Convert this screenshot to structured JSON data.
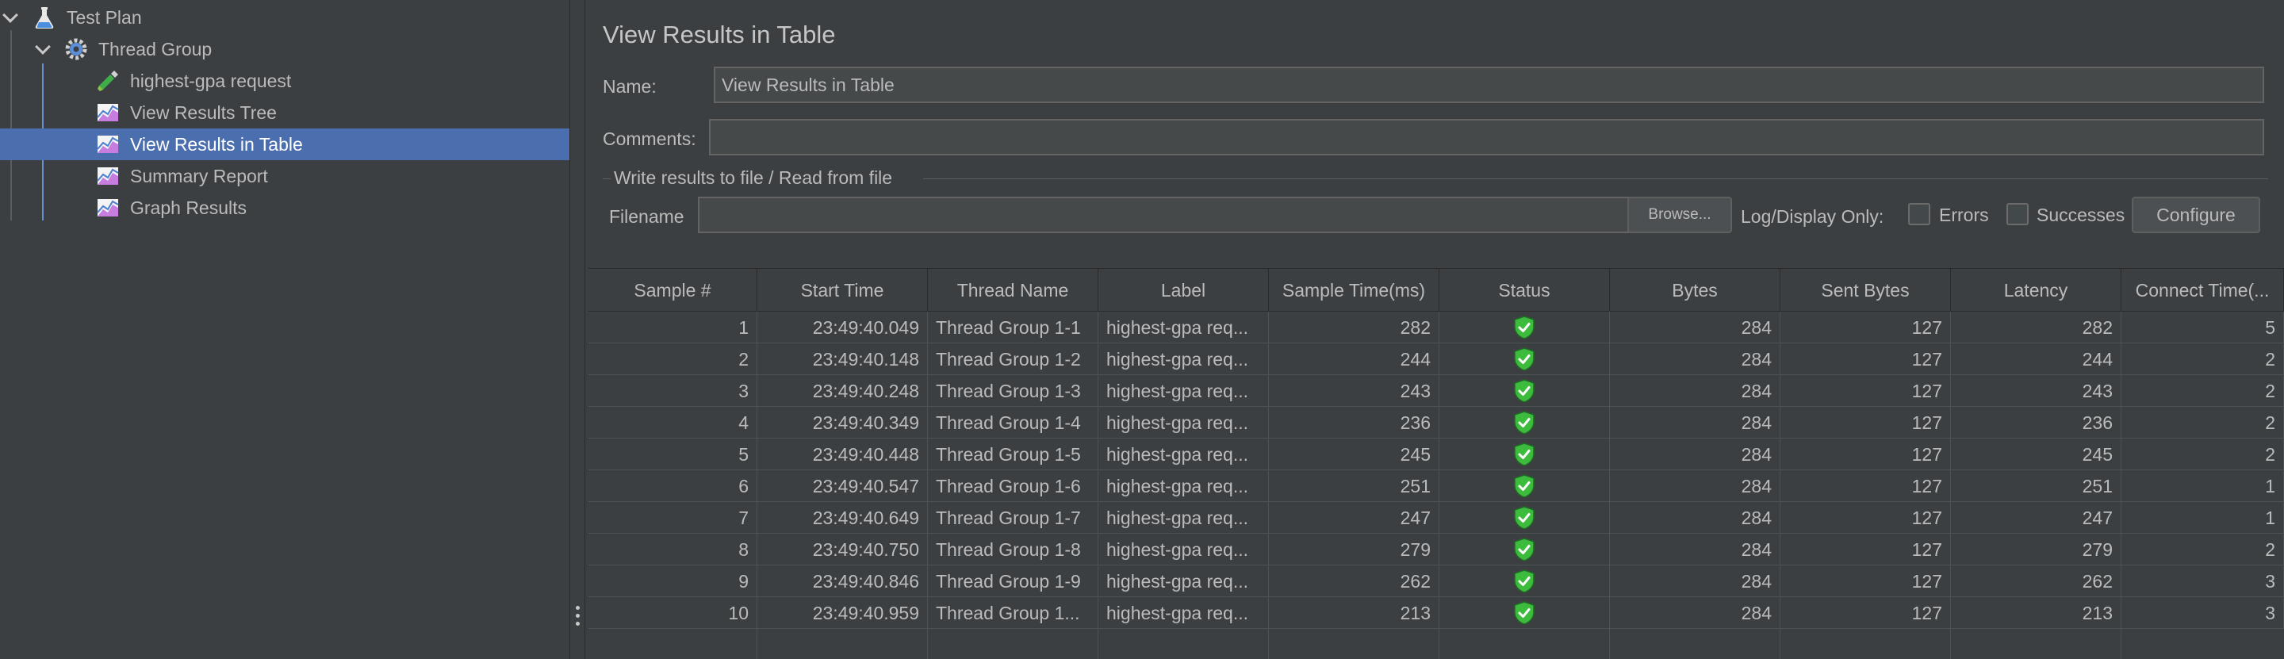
{
  "tree": {
    "items": [
      {
        "label": "Test Plan",
        "icon": "flask-icon"
      },
      {
        "label": "Thread Group",
        "icon": "gear-icon"
      },
      {
        "label": "highest-gpa request",
        "icon": "pipette-icon"
      },
      {
        "label": "View Results Tree",
        "icon": "graph-icon"
      },
      {
        "label": "View Results in Table",
        "icon": "graph-icon"
      },
      {
        "label": "Summary Report",
        "icon": "graph-icon"
      },
      {
        "label": "Graph Results",
        "icon": "graph-icon"
      }
    ],
    "selected_index": 4,
    "selection_color": "#4b6eaf"
  },
  "panel": {
    "title": "View Results in Table",
    "name_label": "Name:",
    "name_value": "View Results in Table",
    "comments_label": "Comments:",
    "comments_value": "",
    "file_group_title": "Write results to file / Read from file",
    "filename_label": "Filename",
    "filename_value": "",
    "browse_label": "Browse...",
    "log_display_label": "Log/Display Only:",
    "errors_label": "Errors",
    "successes_label": "Successes",
    "configure_label": "Configure"
  },
  "table": {
    "columns": [
      "Sample #",
      "Start Time",
      "Thread Name",
      "Label",
      "Sample Time(ms)",
      "Status",
      "Bytes",
      "Sent Bytes",
      "Latency",
      "Connect Time(..."
    ],
    "rows": [
      [
        "1",
        "23:49:40.049",
        "Thread Group 1-1",
        "highest-gpa req...",
        "282",
        "success",
        "284",
        "127",
        "282",
        "5"
      ],
      [
        "2",
        "23:49:40.148",
        "Thread Group 1-2",
        "highest-gpa req...",
        "244",
        "success",
        "284",
        "127",
        "244",
        "2"
      ],
      [
        "3",
        "23:49:40.248",
        "Thread Group 1-3",
        "highest-gpa req...",
        "243",
        "success",
        "284",
        "127",
        "243",
        "2"
      ],
      [
        "4",
        "23:49:40.349",
        "Thread Group 1-4",
        "highest-gpa req...",
        "236",
        "success",
        "284",
        "127",
        "236",
        "2"
      ],
      [
        "5",
        "23:49:40.448",
        "Thread Group 1-5",
        "highest-gpa req...",
        "245",
        "success",
        "284",
        "127",
        "245",
        "2"
      ],
      [
        "6",
        "23:49:40.547",
        "Thread Group 1-6",
        "highest-gpa req...",
        "251",
        "success",
        "284",
        "127",
        "251",
        "1"
      ],
      [
        "7",
        "23:49:40.649",
        "Thread Group 1-7",
        "highest-gpa req...",
        "247",
        "success",
        "284",
        "127",
        "247",
        "1"
      ],
      [
        "8",
        "23:49:40.750",
        "Thread Group 1-8",
        "highest-gpa req...",
        "279",
        "success",
        "284",
        "127",
        "279",
        "2"
      ],
      [
        "9",
        "23:49:40.846",
        "Thread Group 1-9",
        "highest-gpa req...",
        "262",
        "success",
        "284",
        "127",
        "262",
        "3"
      ],
      [
        "10",
        "23:49:40.959",
        "Thread Group 1...",
        "highest-gpa req...",
        "213",
        "success",
        "284",
        "127",
        "213",
        "3"
      ]
    ],
    "status_icon": "shield-check-icon",
    "status_color": "#3dbb3d"
  }
}
